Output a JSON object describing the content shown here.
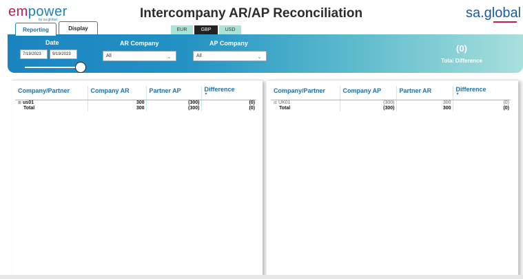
{
  "header": {
    "logo_left_part1": "em",
    "logo_left_part2": "power",
    "logo_left_sub": "by sa.global",
    "title": "Intercompany AR/AP Reconciliation",
    "logo_right": "sa.global"
  },
  "tabs": [
    {
      "label": "Reporting",
      "active": true
    },
    {
      "label": "Display",
      "active": false
    }
  ],
  "currency": {
    "options": [
      "EUR",
      "GBP",
      "USD"
    ],
    "selected": "GBP"
  },
  "filters": {
    "date_label": "Date",
    "date_start": "7/19/2023",
    "date_end": "9/19/2023",
    "ar_company_label": "AR Company",
    "ar_company_value": "All",
    "ap_company_label": "AP Company",
    "ap_company_value": "All"
  },
  "summary": {
    "total_difference_value": "(0)",
    "total_difference_label": "Total Difference"
  },
  "ar_table": {
    "headers": [
      "Company/Partner",
      "Company AR",
      "Partner AP",
      "Difference"
    ],
    "rows": [
      {
        "name": "us01",
        "company_ar": "300",
        "partner_ap": "(300)",
        "difference": "(0)"
      },
      {
        "name": "Total",
        "company_ar": "300",
        "partner_ap": "(300)",
        "difference": "(0)"
      }
    ]
  },
  "ap_table": {
    "headers": [
      "Company/Partner",
      "Company AP",
      "Partner AR",
      "Difference"
    ],
    "rows": [
      {
        "name": "UK01",
        "company_ap": "(300)",
        "partner_ar": "300",
        "difference": "(0)"
      },
      {
        "name": "Total",
        "company_ap": "(300)",
        "partner_ar": "300",
        "difference": "(0)"
      }
    ]
  },
  "colors": {
    "brand_blue": "#1f7fb8",
    "accent_magenta": "#c2185b",
    "band_start": "#1a84c0",
    "band_end": "#a8e0dc",
    "currency_bg": "#a9e4d6"
  }
}
